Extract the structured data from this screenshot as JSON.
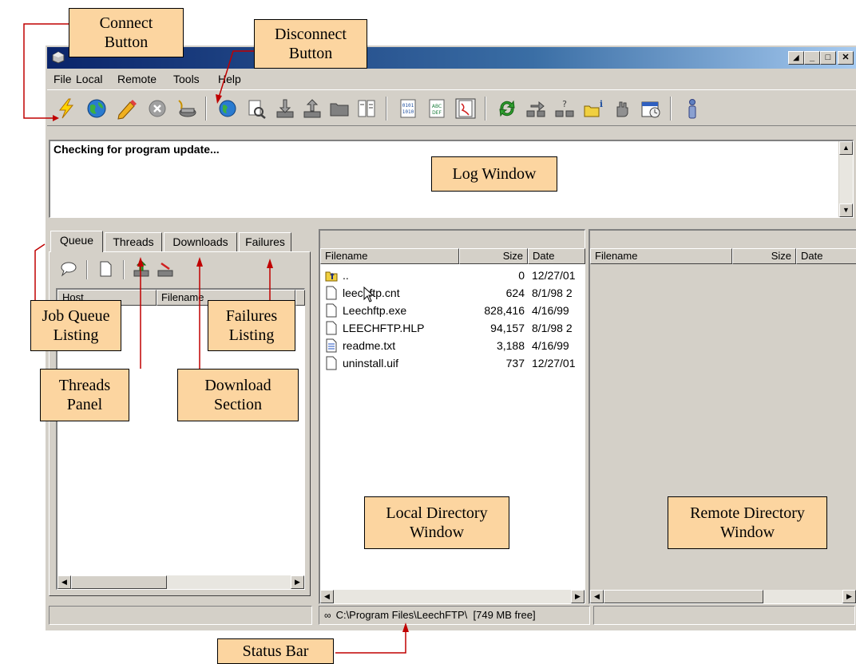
{
  "window": {
    "minimize_glyph": "_",
    "maximize_glyph": "□",
    "close_glyph": "✕"
  },
  "menu": [
    "File",
    "Local",
    "Remote",
    "Tools",
    "Help"
  ],
  "log": {
    "text": "Checking for program update..."
  },
  "tabs": [
    {
      "label": "Queue",
      "active": true
    },
    {
      "label": "Threads",
      "active": false
    },
    {
      "label": "Downloads",
      "active": false
    },
    {
      "label": "Failures",
      "active": false
    }
  ],
  "queue": {
    "columns": [
      "Host",
      "Filename"
    ]
  },
  "local_pane": {
    "columns": [
      "Filename",
      "Size",
      "Date"
    ],
    "rows": [
      {
        "icon": "folder-up-icon",
        "name": "..",
        "size": "0",
        "date": "12/27/01"
      },
      {
        "icon": "file-icon",
        "name": "leechftp.cnt",
        "size": "624",
        "date": "8/1/98 2"
      },
      {
        "icon": "file-icon",
        "name": "Leechftp.exe",
        "size": "828,416",
        "date": "4/16/99"
      },
      {
        "icon": "file-icon",
        "name": "LEECHFTP.HLP",
        "size": "94,157",
        "date": "8/1/98 2"
      },
      {
        "icon": "text-file-icon",
        "name": "readme.txt",
        "size": "3,188",
        "date": "4/16/99"
      },
      {
        "icon": "file-icon",
        "name": "uninstall.uif",
        "size": "737",
        "date": "12/27/01"
      }
    ]
  },
  "remote_pane": {
    "columns": [
      "Filename",
      "Size",
      "Date"
    ]
  },
  "status": {
    "path": "C:\\Program Files\\LeechFTP\\",
    "free": "[749 MB free]"
  },
  "callouts": {
    "connect": "Connect\nButton",
    "disconnect": "Disconnect\nButton",
    "log": "Log Window",
    "job_queue": "Job Queue\nListing",
    "failures": "Failures\nListing",
    "threads": "Threads\nPanel",
    "download": "Download\nSection",
    "local_dir": "Local Directory\nWindow",
    "remote_dir": "Remote Directory\nWindow",
    "status_bar": "Status Bar"
  },
  "colors": {
    "title_start": "#0a246a",
    "title_end": "#a6caf0",
    "chrome": "#d4d0c8",
    "callout": "#fcd5a0"
  }
}
